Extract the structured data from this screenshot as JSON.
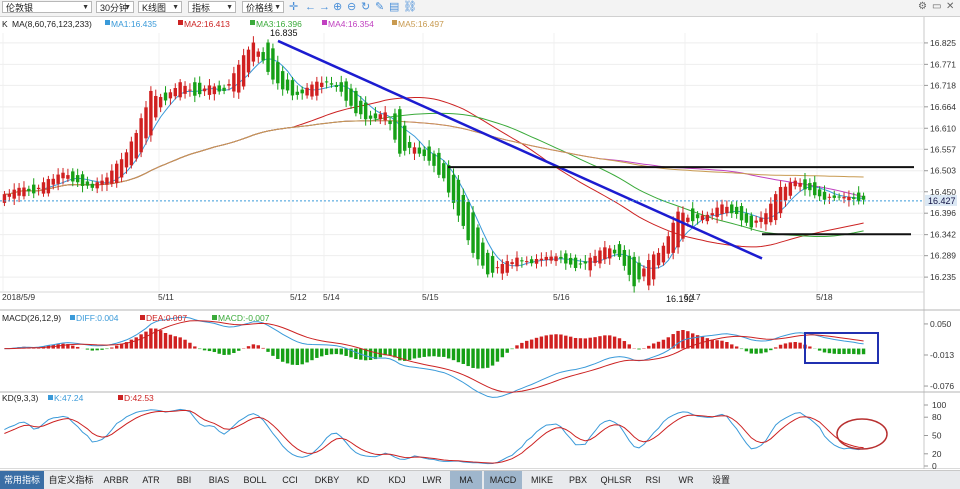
{
  "toolbar": {
    "symbol": "伦敦银",
    "period": "30分钟",
    "chart_type": "K线图",
    "indicator": "指标",
    "price_line": "价格线"
  },
  "main_legend": {
    "label": "K",
    "params": "MA(8,60,76,123,233)",
    "ma1": "MA1:16.435",
    "ma2": "MA2:16.413",
    "ma3": "MA3:16.396",
    "ma4": "MA4:16.354",
    "ma5": "MA5:16.497"
  },
  "macd_legend": {
    "params": "MACD(26,12,9)",
    "diff": "DIFF:0.004",
    "dea": "DEA:0.007",
    "macd": "MACD:-0.007"
  },
  "kd_legend": {
    "params": "KD(9,3,3)",
    "k": "K:47.24",
    "d": "D:42.53"
  },
  "price_annotations": {
    "high": "16.835",
    "low": "16.192",
    "current": "16.427"
  },
  "bottom_tabs": [
    "常用指标",
    "自定义指标",
    "ARBR",
    "ATR",
    "BBI",
    "BIAS",
    "BOLL",
    "CCI",
    "DKBY",
    "KD",
    "KDJ",
    "LWR",
    "MA",
    "MACD",
    "MIKE",
    "PBX",
    "QHLSR",
    "RSI",
    "WR",
    "设置"
  ],
  "colors": {
    "up": "#d02020",
    "down": "#16a016",
    "trendline": "#1c1cd0",
    "ma1": "#3a9ad9",
    "ma2": "#cc2222",
    "ma3": "#3aaa3a",
    "ma4": "#c040c0",
    "ma5": "#c89a50",
    "diff": "#3a9ad9",
    "dea": "#cc2222",
    "k": "#3a9ad9",
    "d": "#cc2222"
  },
  "chart_data": [
    {
      "type": "candlestick",
      "title": "伦敦银 30分钟",
      "x_labels": [
        "2018/5/9",
        "5/11",
        "5/12",
        "5/14",
        "5/15",
        "5/16",
        "5/17",
        "5/18"
      ],
      "y_ticks": [
        "16.825",
        "16.771",
        "16.718",
        "16.664",
        "16.610",
        "16.557",
        "16.503",
        "16.450",
        "16.396",
        "16.342",
        "16.289",
        "16.235"
      ],
      "ylim": [
        16.2,
        16.85
      ],
      "ohlc_approx": [
        [
          16.43,
          16.46,
          16.41,
          16.44
        ],
        [
          16.44,
          16.48,
          16.43,
          16.46
        ],
        [
          16.46,
          16.47,
          16.44,
          16.45
        ],
        [
          16.45,
          16.5,
          16.45,
          16.48
        ],
        [
          16.48,
          16.53,
          16.47,
          16.5
        ],
        [
          16.5,
          16.51,
          16.46,
          16.47
        ],
        [
          16.47,
          16.48,
          16.44,
          16.46
        ],
        [
          16.46,
          16.5,
          16.45,
          16.49
        ],
        [
          16.49,
          16.55,
          16.48,
          16.53
        ],
        [
          16.53,
          16.62,
          16.52,
          16.6
        ],
        [
          16.6,
          16.72,
          16.59,
          16.7
        ],
        [
          16.7,
          16.73,
          16.66,
          16.68
        ],
        [
          16.68,
          16.75,
          16.66,
          16.73
        ],
        [
          16.73,
          16.74,
          16.68,
          16.69
        ],
        [
          16.69,
          16.73,
          16.68,
          16.72
        ],
        [
          16.72,
          16.74,
          16.69,
          16.7
        ],
        [
          16.7,
          16.78,
          16.69,
          16.77
        ],
        [
          16.77,
          16.84,
          16.76,
          16.83
        ],
        [
          16.83,
          16.84,
          16.74,
          16.75
        ],
        [
          16.75,
          16.76,
          16.7,
          16.71
        ],
        [
          16.71,
          16.73,
          16.67,
          16.69
        ],
        [
          16.69,
          16.73,
          16.68,
          16.72
        ],
        [
          16.72,
          16.74,
          16.7,
          16.73
        ],
        [
          16.73,
          16.74,
          16.69,
          16.7
        ],
        [
          16.7,
          16.72,
          16.64,
          16.65
        ],
        [
          16.65,
          16.67,
          16.61,
          16.63
        ],
        [
          16.63,
          16.66,
          16.62,
          16.65
        ],
        [
          16.65,
          16.66,
          16.53,
          16.55
        ],
        [
          16.55,
          16.57,
          16.51,
          16.56
        ],
        [
          16.56,
          16.57,
          16.52,
          16.53
        ],
        [
          16.53,
          16.54,
          16.47,
          16.48
        ],
        [
          16.48,
          16.49,
          16.38,
          16.39
        ],
        [
          16.39,
          16.4,
          16.28,
          16.3
        ],
        [
          16.3,
          16.31,
          16.22,
          16.24
        ],
        [
          16.24,
          16.28,
          16.23,
          16.27
        ],
        [
          16.27,
          16.3,
          16.25,
          16.28
        ],
        [
          16.28,
          16.3,
          16.26,
          16.27
        ],
        [
          16.27,
          16.31,
          16.26,
          16.29
        ],
        [
          16.29,
          16.31,
          16.27,
          16.28
        ],
        [
          16.28,
          16.3,
          16.25,
          16.26
        ],
        [
          16.26,
          16.29,
          16.25,
          16.28
        ],
        [
          16.28,
          16.32,
          16.27,
          16.31
        ],
        [
          16.31,
          16.33,
          16.28,
          16.29
        ],
        [
          16.29,
          16.3,
          16.2,
          16.21
        ],
        [
          16.21,
          16.29,
          16.19,
          16.28
        ],
        [
          16.28,
          16.32,
          16.27,
          16.31
        ],
        [
          16.31,
          16.41,
          16.3,
          16.4
        ],
        [
          16.4,
          16.42,
          16.37,
          16.38
        ],
        [
          16.38,
          16.4,
          16.37,
          16.39
        ],
        [
          16.39,
          16.44,
          16.38,
          16.42
        ],
        [
          16.42,
          16.43,
          16.38,
          16.39
        ],
        [
          16.39,
          16.41,
          16.35,
          16.36
        ],
        [
          16.36,
          16.41,
          16.35,
          16.4
        ],
        [
          16.4,
          16.47,
          16.39,
          16.46
        ],
        [
          16.46,
          16.49,
          16.44,
          16.48
        ],
        [
          16.48,
          16.49,
          16.44,
          16.45
        ],
        [
          16.45,
          16.46,
          16.42,
          16.43
        ],
        [
          16.43,
          16.45,
          16.42,
          16.44
        ],
        [
          16.44,
          16.45,
          16.42,
          16.43
        ]
      ],
      "annotations": [
        "16.835",
        "16.192",
        "16.427"
      ]
    },
    {
      "type": "bar",
      "title": "MACD(26,12,9)",
      "y_ticks": [
        "0.050",
        "-0.013",
        "-0.076"
      ],
      "series": [
        {
          "name": "DIFF",
          "last": 0.004
        },
        {
          "name": "DEA",
          "last": 0.007
        },
        {
          "name": "MACD",
          "last": -0.007
        }
      ]
    },
    {
      "type": "line",
      "title": "KD(9,3,3)",
      "y_ticks": [
        "100",
        "80",
        "50",
        "20",
        "0"
      ],
      "series": [
        {
          "name": "K",
          "last": 47.24
        },
        {
          "name": "D",
          "last": 42.53
        }
      ]
    }
  ]
}
